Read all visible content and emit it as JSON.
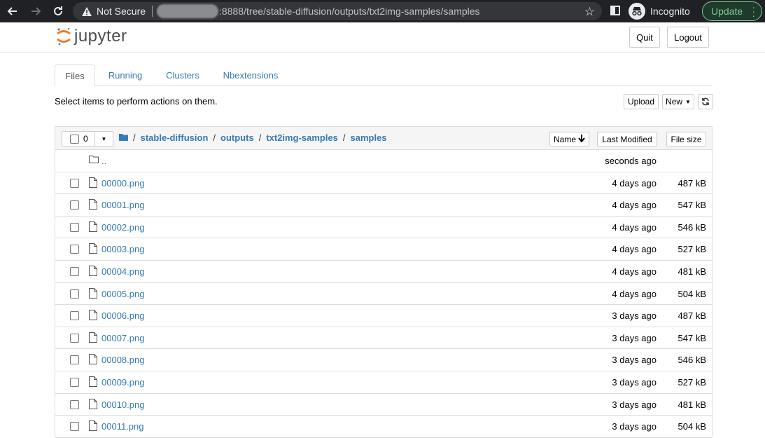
{
  "browser": {
    "security_label": "Not Secure",
    "url": ":8888/tree/stable-diffusion/outputs/txt2img-samples/samples",
    "profile_label": "Incognito",
    "update_label": "Update"
  },
  "header": {
    "logo_text": "jupyter",
    "quit_label": "Quit",
    "logout_label": "Logout"
  },
  "tabs": [
    {
      "label": "Files",
      "active": true
    },
    {
      "label": "Running",
      "active": false
    },
    {
      "label": "Clusters",
      "active": false
    },
    {
      "label": "Nbextensions",
      "active": false
    }
  ],
  "toolbar": {
    "hint": "Select items to perform actions on them.",
    "upload_label": "Upload",
    "new_label": "New"
  },
  "list_header": {
    "selected_count": "0",
    "breadcrumb": [
      "stable-diffusion",
      "outputs",
      "txt2img-samples",
      "samples"
    ],
    "sort_name_label": "Name",
    "sort_modified_label": "Last Modified",
    "sort_size_label": "File size"
  },
  "parent": {
    "name": "..",
    "modified": "seconds ago"
  },
  "files": [
    {
      "name": "00000.png",
      "modified": "4 days ago",
      "size": "487 kB"
    },
    {
      "name": "00001.png",
      "modified": "4 days ago",
      "size": "547 kB"
    },
    {
      "name": "00002.png",
      "modified": "4 days ago",
      "size": "546 kB"
    },
    {
      "name": "00003.png",
      "modified": "4 days ago",
      "size": "527 kB"
    },
    {
      "name": "00004.png",
      "modified": "4 days ago",
      "size": "481 kB"
    },
    {
      "name": "00005.png",
      "modified": "4 days ago",
      "size": "504 kB"
    },
    {
      "name": "00006.png",
      "modified": "3 days ago",
      "size": "487 kB"
    },
    {
      "name": "00007.png",
      "modified": "3 days ago",
      "size": "547 kB"
    },
    {
      "name": "00008.png",
      "modified": "3 days ago",
      "size": "546 kB"
    },
    {
      "name": "00009.png",
      "modified": "3 days ago",
      "size": "527 kB"
    },
    {
      "name": "00010.png",
      "modified": "3 days ago",
      "size": "481 kB"
    },
    {
      "name": "00011.png",
      "modified": "3 days ago",
      "size": "504 kB"
    }
  ],
  "colors": {
    "link": "#337ab7",
    "chrome_bg": "#202124",
    "update_green": "#81c995",
    "logo_orange": "#f37726"
  }
}
